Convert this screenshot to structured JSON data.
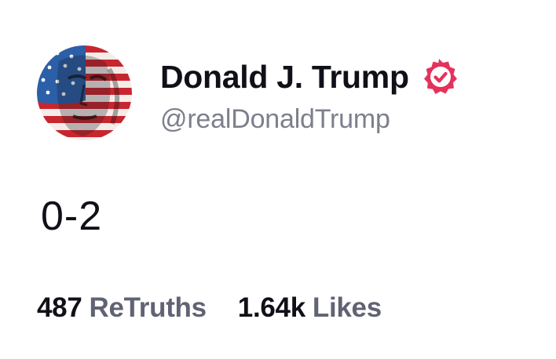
{
  "author": {
    "display_name": "Donald J. Trump",
    "handle": "@realDonaldTrump",
    "verified": true,
    "badge_color": "#e4325b",
    "avatar_icon": "flag-portrait-avatar"
  },
  "post": {
    "text": "0-2"
  },
  "stats": {
    "retruths_count": "487",
    "retruths_label": "ReTruths",
    "likes_count": "1.64k",
    "likes_label": "Likes"
  },
  "colors": {
    "text_primary": "#101018",
    "text_secondary": "#7d7f8c",
    "stat_label": "#606374",
    "flag_red": "#c8262f",
    "flag_blue": "#2b5fa8"
  }
}
